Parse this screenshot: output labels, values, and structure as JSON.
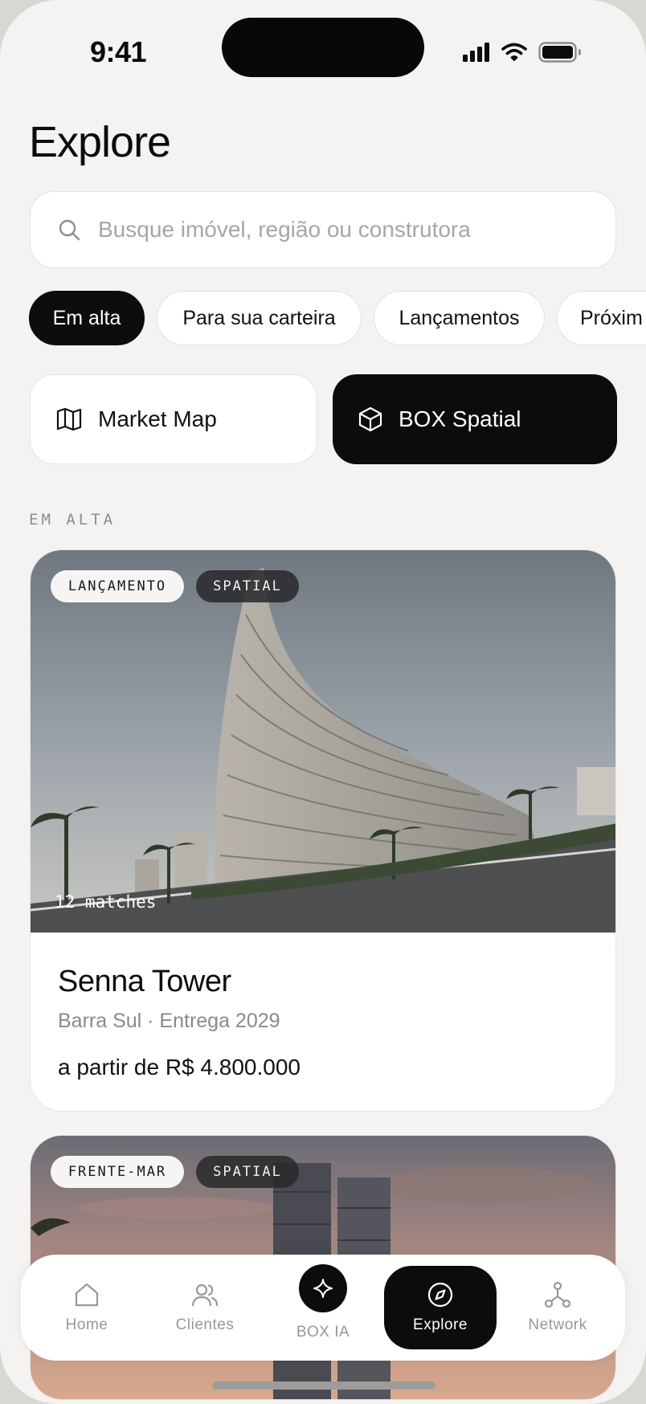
{
  "status_bar": {
    "time": "9:41",
    "icons": [
      "signal-icon",
      "wifi-icon",
      "battery-icon"
    ]
  },
  "header": {
    "title": "Explore"
  },
  "search": {
    "placeholder": "Busque imóvel, região ou construtora",
    "icon": "search-icon"
  },
  "filters": [
    {
      "label": "Em alta",
      "active": true
    },
    {
      "label": "Para sua carteira",
      "active": false
    },
    {
      "label": "Lançamentos",
      "active": false
    },
    {
      "label": "Próxim",
      "active": false
    }
  ],
  "actions": {
    "market_map": {
      "label": "Market Map",
      "icon": "map-icon"
    },
    "box_spatial": {
      "label": "BOX Spatial",
      "icon": "cube-icon"
    }
  },
  "section": {
    "label": "EM ALTA"
  },
  "listings": [
    {
      "tags": [
        "LANÇAMENTO",
        "SPATIAL"
      ],
      "matches": "12 matches",
      "name": "Senna Tower",
      "subtitle": "Barra Sul · Entrega 2029",
      "price": "a partir de R$ 4.800.000"
    },
    {
      "tags": [
        "FRENTE-MAR",
        "SPATIAL"
      ]
    }
  ],
  "tabbar": {
    "items": [
      {
        "label": "Home",
        "icon": "home-icon"
      },
      {
        "label": "Clientes",
        "icon": "users-icon"
      },
      {
        "label": "BOX IA",
        "icon": "sparkle-icon"
      },
      {
        "label": "Explore",
        "icon": "compass-icon",
        "active": true
      },
      {
        "label": "Network",
        "icon": "network-icon"
      }
    ]
  },
  "colors": {
    "background": "#f4f3f1",
    "accent": "#0c0c0c",
    "muted_text": "#8c8a87"
  }
}
